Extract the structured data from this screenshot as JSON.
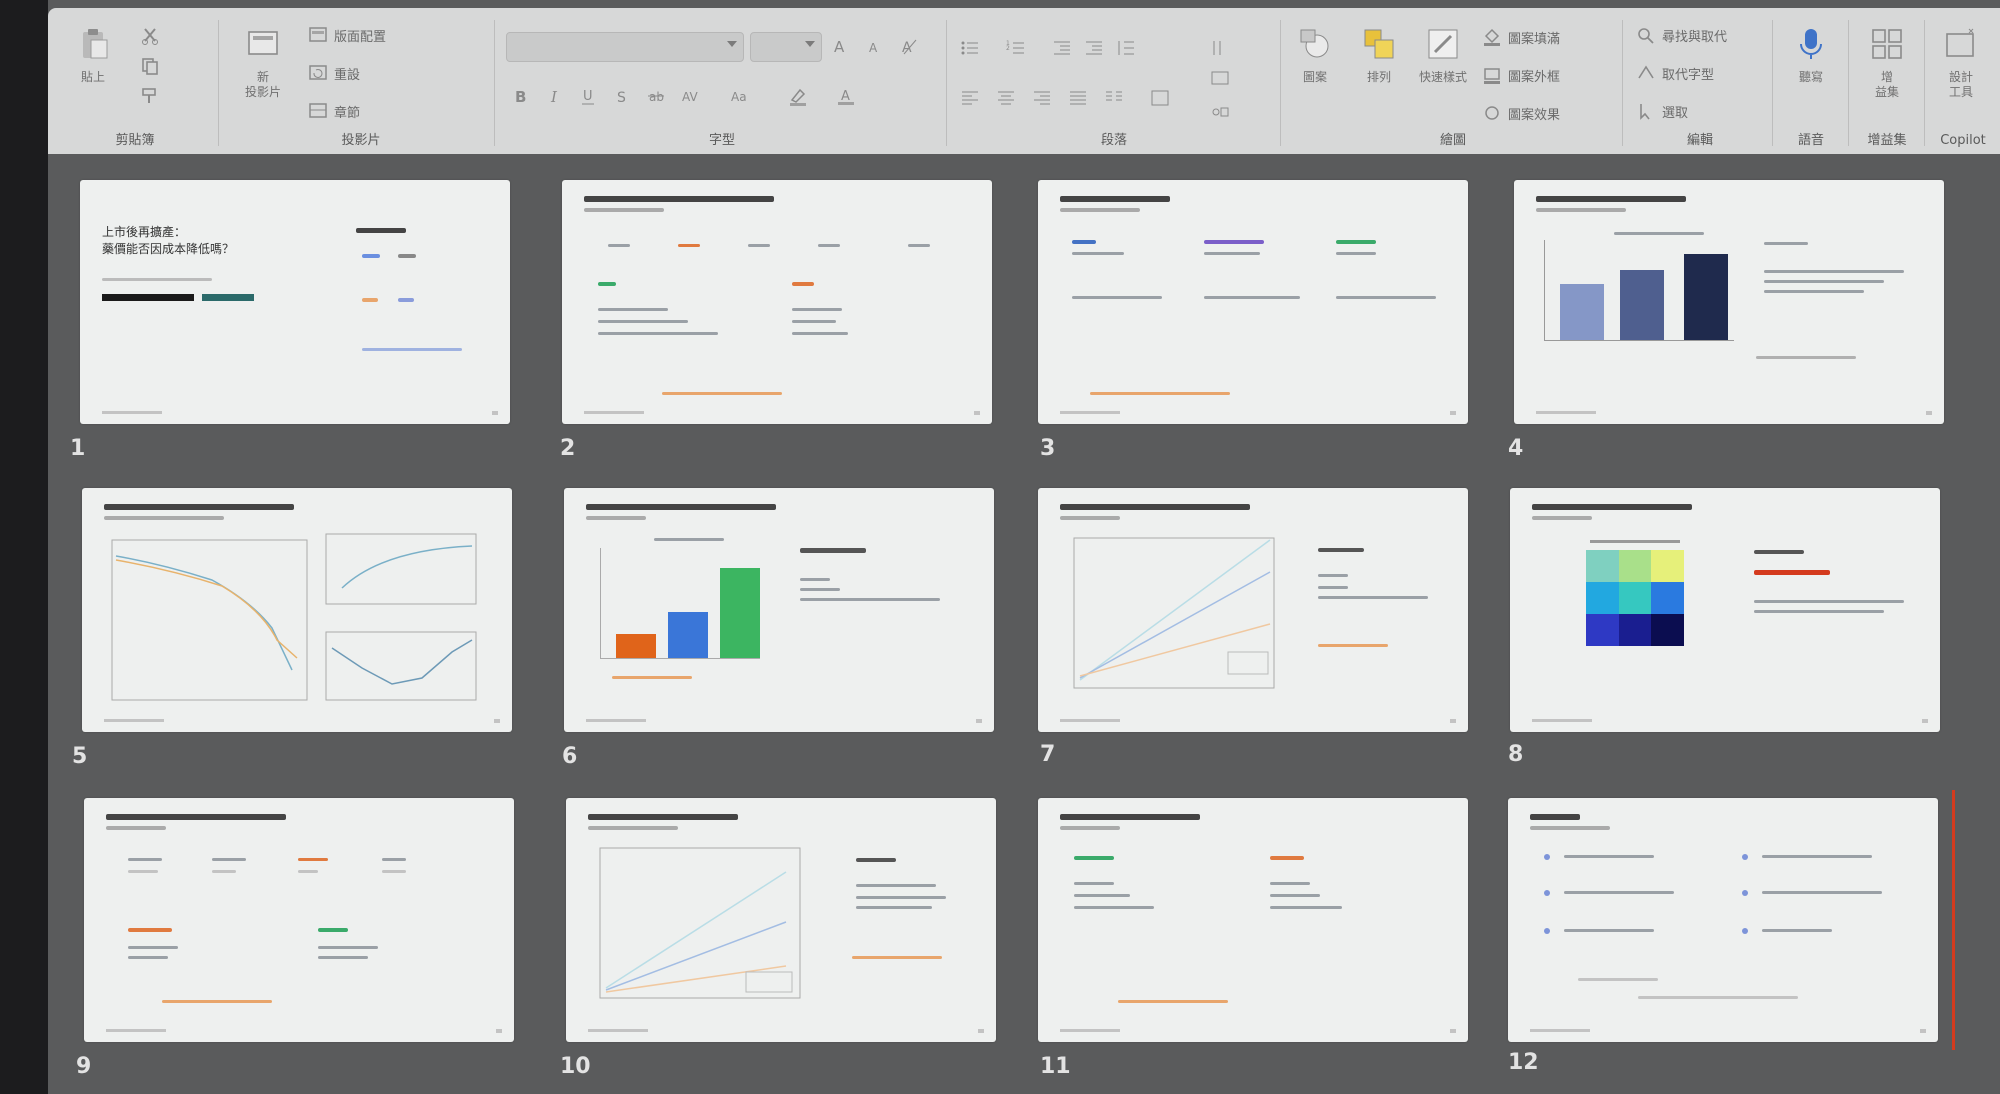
{
  "ribbon": {
    "groups": [
      {
        "id": "clipboard",
        "label": "剪貼簿",
        "buttons": [
          {
            "label": "貼上"
          }
        ]
      },
      {
        "id": "slides",
        "label": "投影片",
        "buttons": [
          {
            "label": "新\n投影片"
          },
          {
            "label": "版面配置"
          },
          {
            "label": "重設"
          },
          {
            "label": "章節"
          }
        ]
      },
      {
        "id": "font",
        "label": "字型"
      },
      {
        "id": "paragraph",
        "label": "段落"
      },
      {
        "id": "drawing",
        "label": "繪圖",
        "buttons": [
          {
            "label": "圖案"
          },
          {
            "label": "排列"
          },
          {
            "label": "快速樣式"
          },
          {
            "label": "圖案填滿"
          },
          {
            "label": "圖案外框"
          },
          {
            "label": "圖案效果"
          }
        ]
      },
      {
        "id": "editing",
        "label": "編輯",
        "buttons": [
          {
            "label": "尋找與取代"
          },
          {
            "label": "取代字型"
          },
          {
            "label": "選取"
          }
        ]
      },
      {
        "id": "voice",
        "label": "語音",
        "buttons": [
          {
            "label": "聽寫"
          }
        ]
      },
      {
        "id": "addins",
        "label": "增益集",
        "buttons": [
          {
            "label": "增\n益集"
          }
        ]
      },
      {
        "id": "copilot",
        "label": "Copilot",
        "buttons": [
          {
            "label": "設計\n工具"
          }
        ]
      }
    ]
  },
  "slides": [
    {
      "n": "1",
      "title": "上市後再擴產：\n藥價能否因成本降低嗎？"
    },
    {
      "n": "2"
    },
    {
      "n": "3"
    },
    {
      "n": "4"
    },
    {
      "n": "5"
    },
    {
      "n": "6"
    },
    {
      "n": "7"
    },
    {
      "n": "8"
    },
    {
      "n": "9"
    },
    {
      "n": "10"
    },
    {
      "n": "11"
    },
    {
      "n": "12"
    }
  ],
  "colors": {
    "ribbon_bg": "#d7d8d8",
    "workspace_bg": "#5a5b5c",
    "slide_bg": "#eef0ef",
    "accent_orange": "#e07a3f",
    "accent_blue": "#4472c4",
    "accent_green": "#3aaa6a",
    "accent_red": "#d43b1e"
  }
}
